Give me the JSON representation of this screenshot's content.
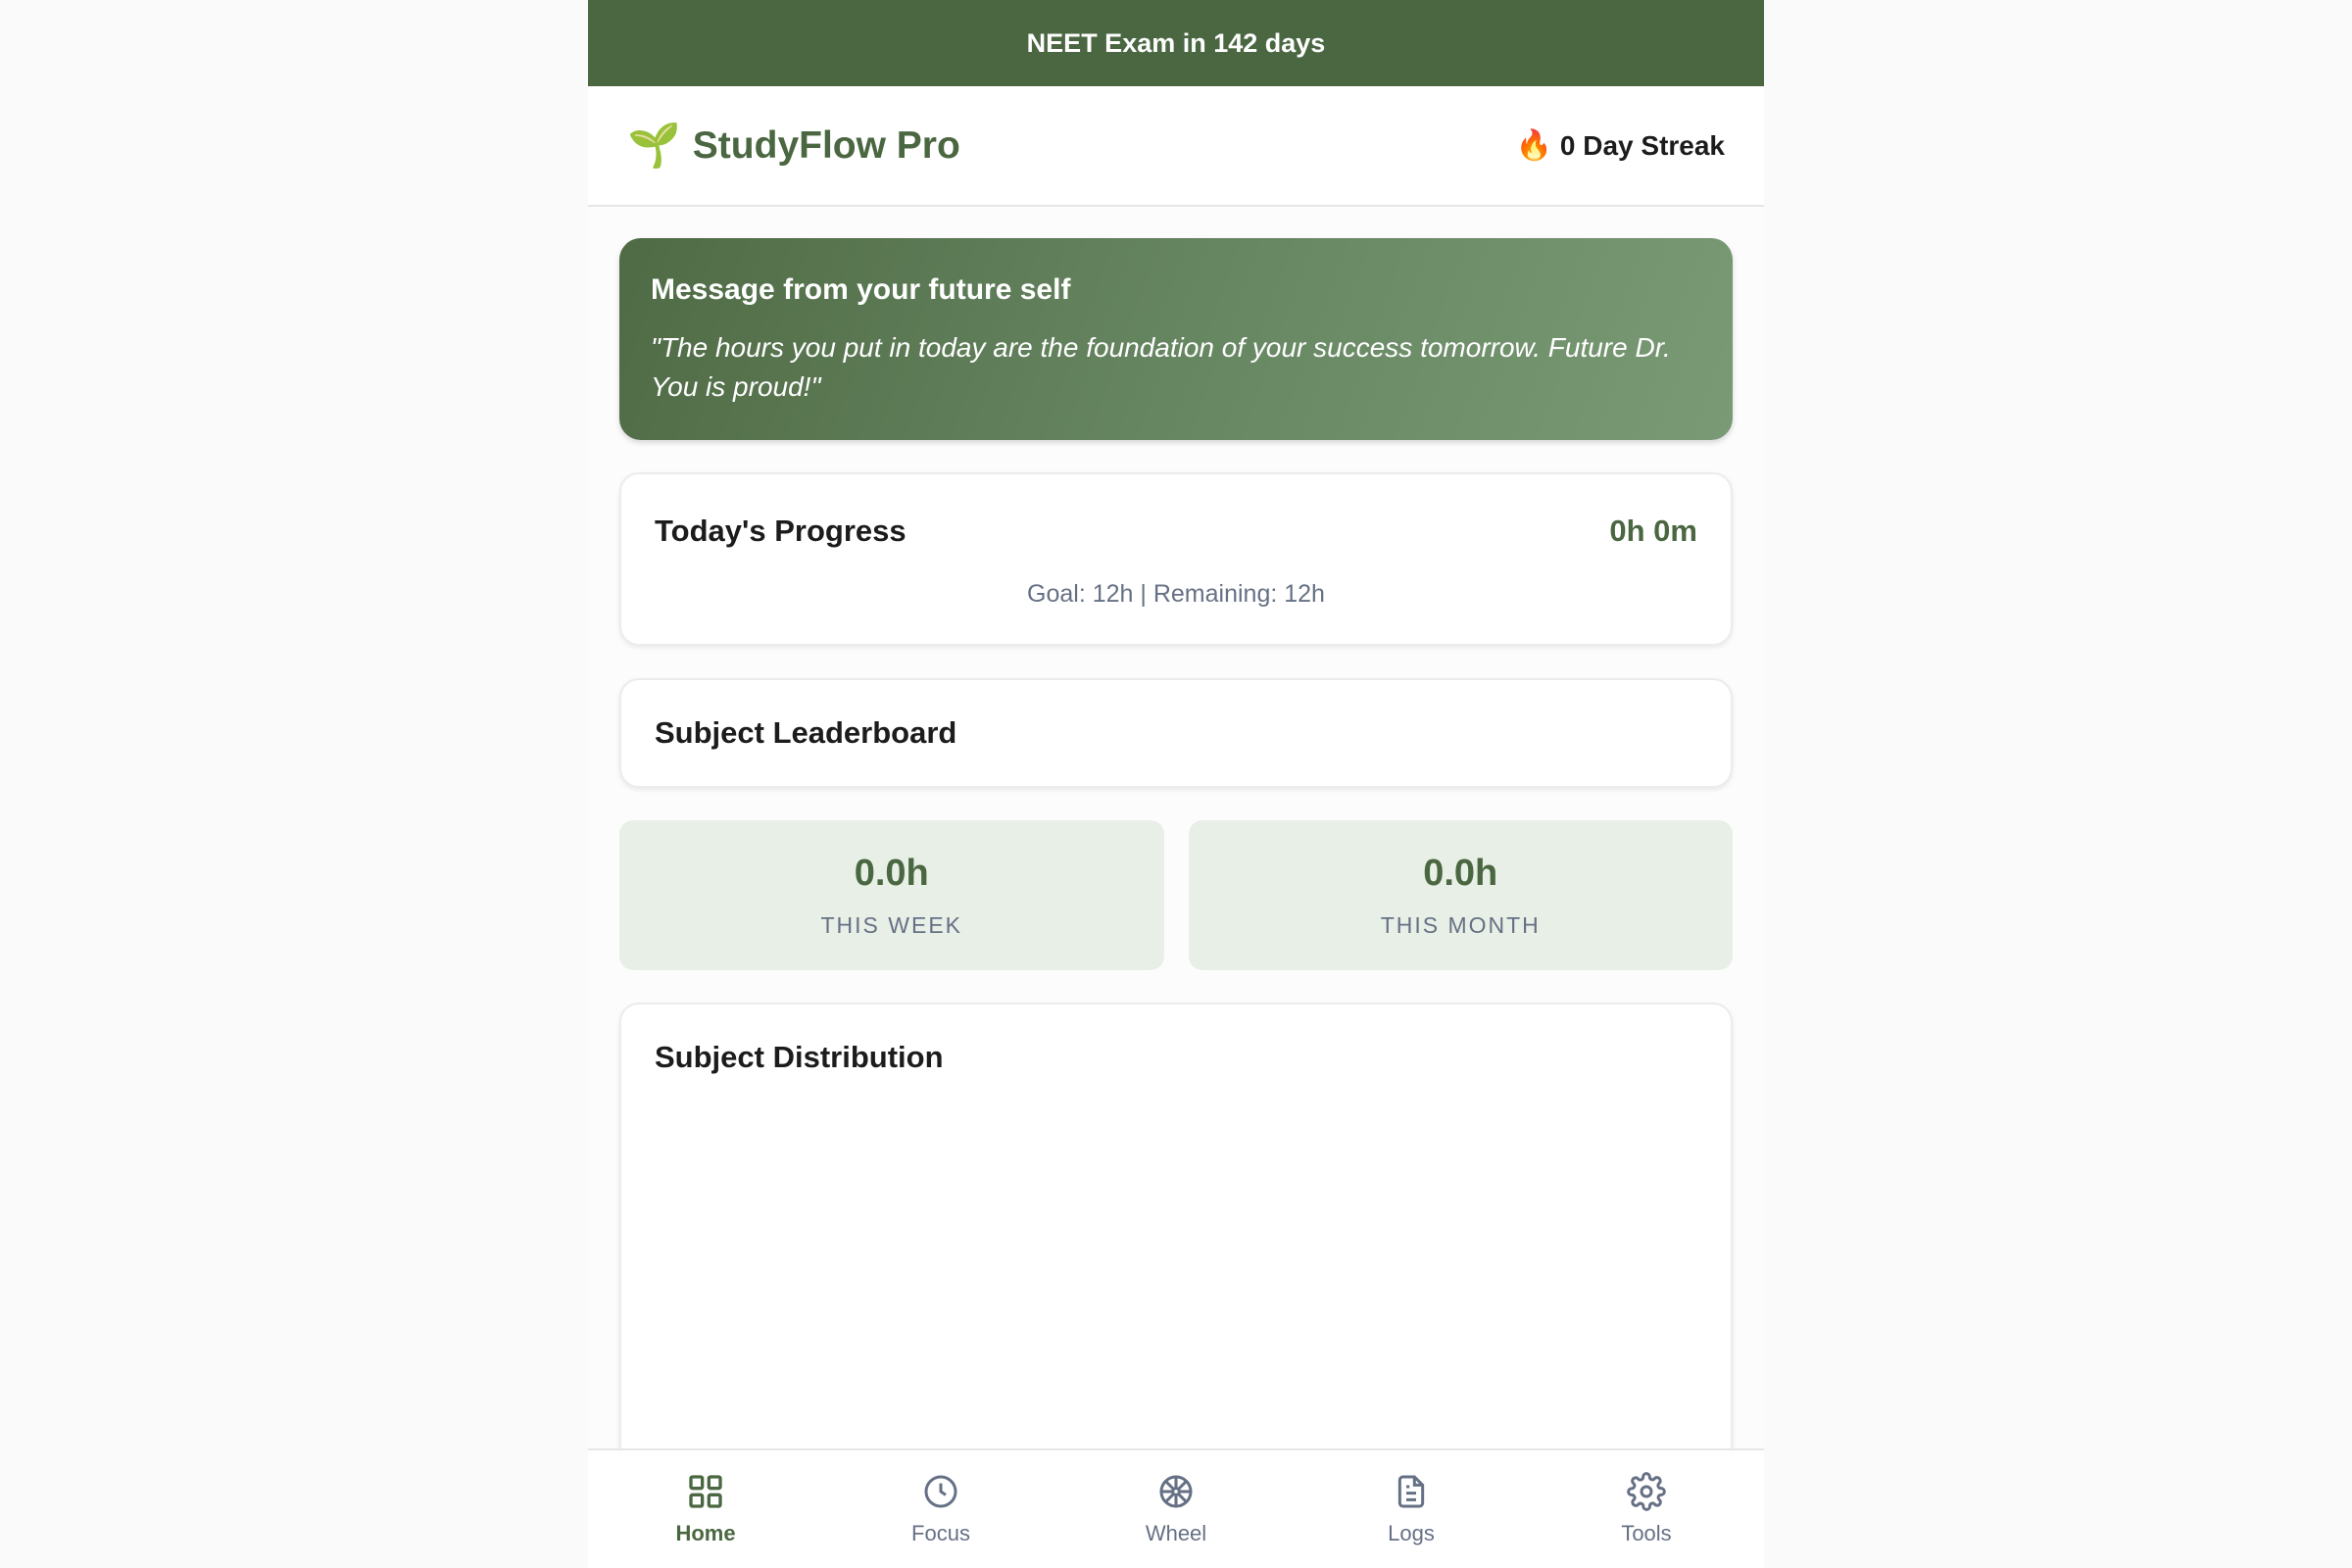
{
  "banner": {
    "text": "NEET Exam in 142 days"
  },
  "header": {
    "brand_icon": "🌱",
    "brand_name": "StudyFlow Pro",
    "streak_icon": "🔥",
    "streak_text": "0 Day Streak"
  },
  "quote": {
    "title": "Message from your future self",
    "text": "\"The hours you put in today are the foundation of your success tomorrow. Future Dr. You is proud!\""
  },
  "progress": {
    "title": "Today's Progress",
    "time": "0h 0m",
    "subtitle": "Goal: 12h | Remaining: 12h"
  },
  "leaderboard": {
    "title": "Subject Leaderboard"
  },
  "stats": [
    {
      "value": "0.0h",
      "label": "THIS WEEK"
    },
    {
      "value": "0.0h",
      "label": "THIS MONTH"
    }
  ],
  "distribution": {
    "title": "Subject Distribution"
  },
  "nav": {
    "items": [
      {
        "label": "Home",
        "icon": "grid-icon",
        "active": true
      },
      {
        "label": "Focus",
        "icon": "clock-icon",
        "active": false
      },
      {
        "label": "Wheel",
        "icon": "wheel-icon",
        "active": false
      },
      {
        "label": "Logs",
        "icon": "document-icon",
        "active": false
      },
      {
        "label": "Tools",
        "icon": "gear-icon",
        "active": false
      }
    ]
  },
  "colors": {
    "primary": "#4a6741",
    "muted": "#667085",
    "stat_bg": "#e8efe6"
  }
}
